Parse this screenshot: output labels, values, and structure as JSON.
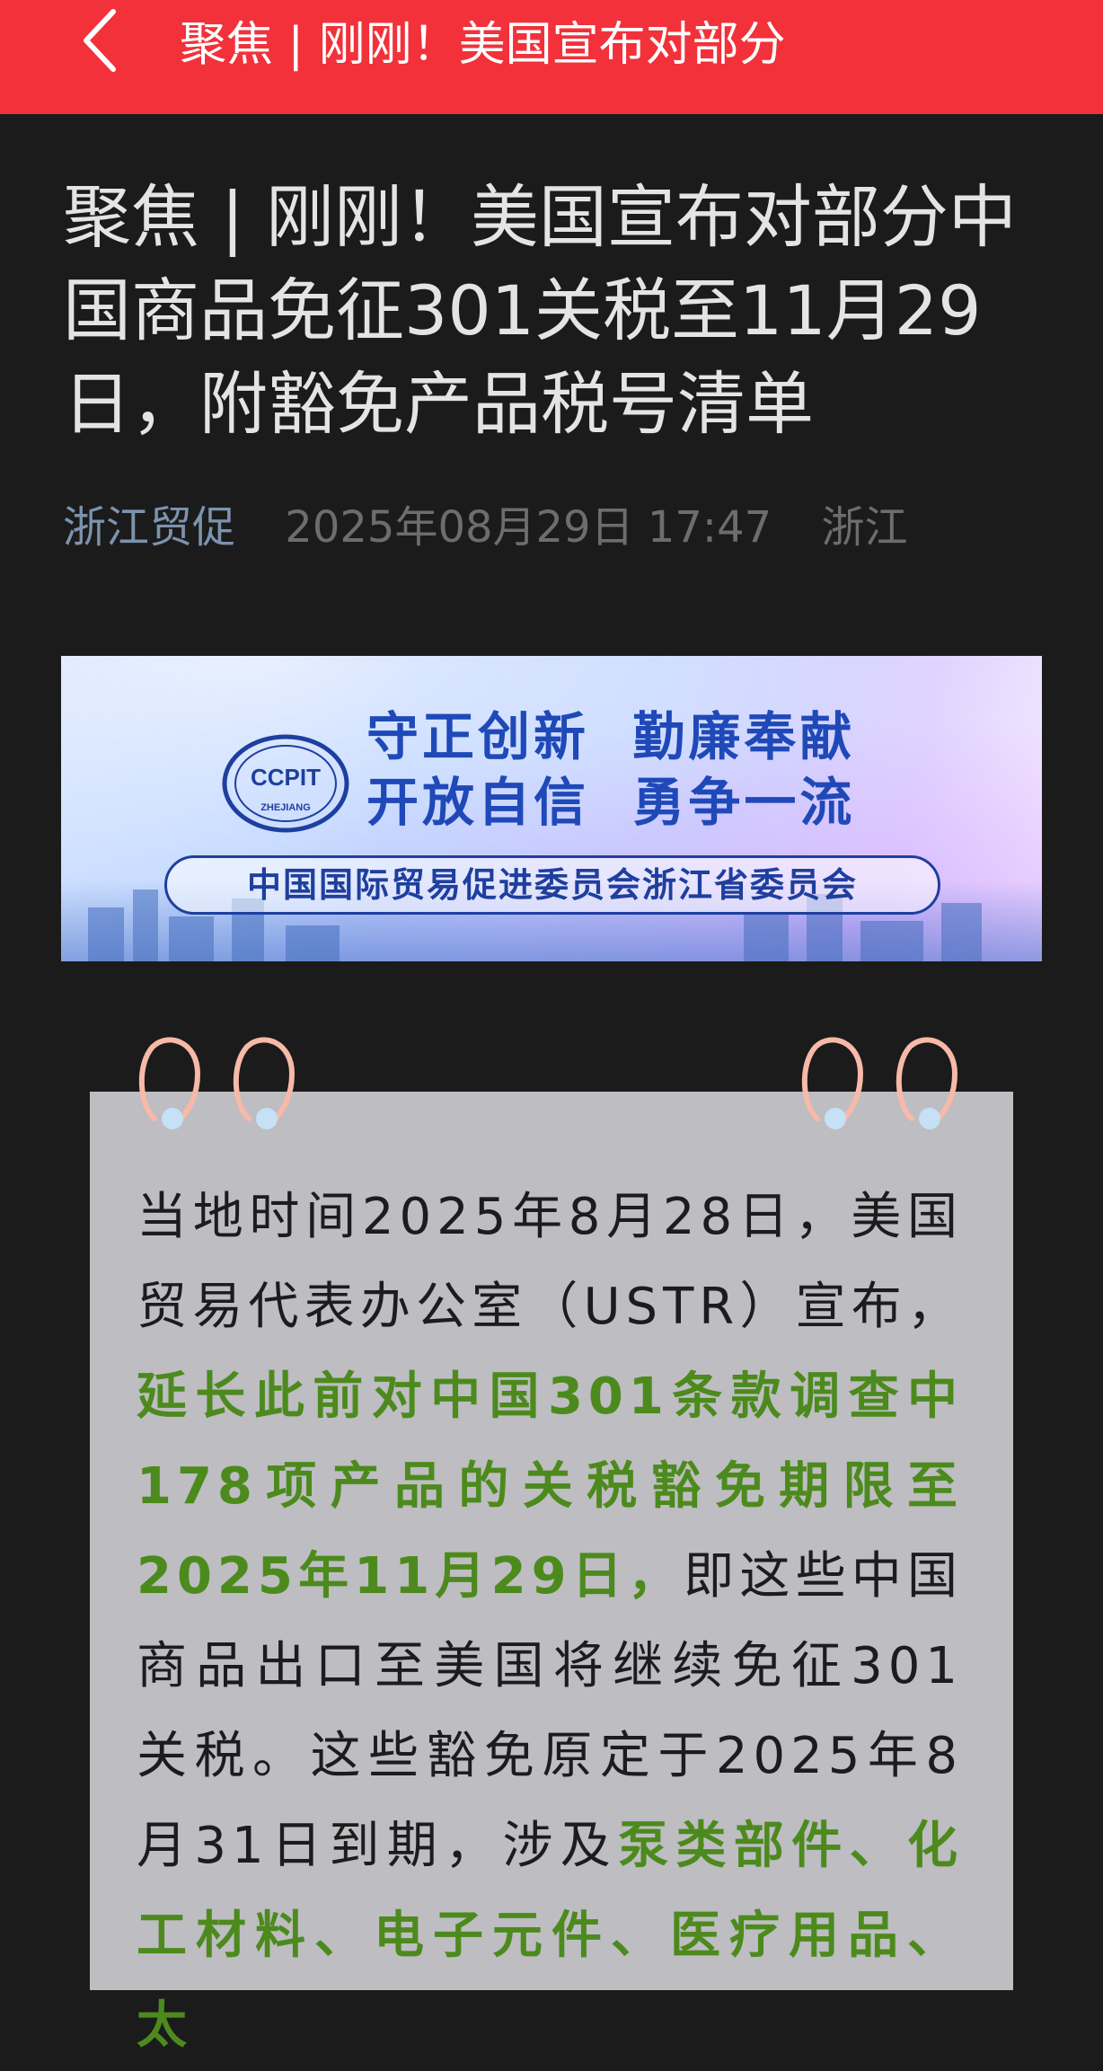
{
  "header": {
    "back_label": "",
    "title": "聚焦 | 刚刚！美国宣布对部分"
  },
  "article": {
    "title": "聚焦 | 刚刚！美国宣布对部分中国商品免征301关税至11月29日，附豁免产品税号清单",
    "source": "浙江贸促",
    "time": "2025年08月29日 17:47",
    "region": "浙江"
  },
  "banner": {
    "logo_text": "CCPIT",
    "logo_sub": "ZHEJIANG",
    "slogan_line1": "守正创新  勤廉奉献",
    "slogan_line2": "开放自信  勇争一流",
    "org_name": "中国国际贸易促进委员会浙江省委员会"
  },
  "body": {
    "seg1": "当地时间2025年8月28日，美国贸易代表办公室（USTR）宣布，",
    "seg2_highlight": "延长此前对中国301条款调查中178项产品的关税豁免期限至2025年11月29日，",
    "seg3": "即这些中国商品出口至美国将继续免征301关税。这些豁免原定于2025年8月31日到期，涉及",
    "seg4_highlight": "泵类部件、化工材料、电子元件、医疗用品、太"
  },
  "colors": {
    "topbar": "#f2313a",
    "background": "#1b1b1b",
    "highlight_green": "#4d8a1d",
    "source_blue": "#7c93ad",
    "banner_blue": "#1f49b8"
  }
}
